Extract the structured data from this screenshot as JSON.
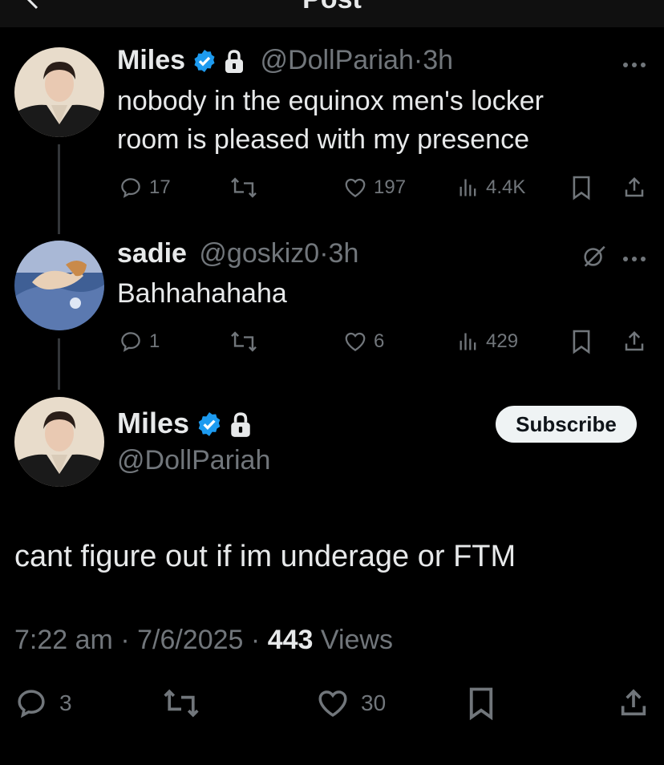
{
  "topbar": {
    "title": "Post"
  },
  "thread": [
    {
      "name": "Miles",
      "handle": "@DollPariah",
      "dot": "·",
      "time": "3h",
      "verified": true,
      "protected": true,
      "text_line1": "nobody in the equinox men's locker",
      "text_line2": "room is pleased with my presence",
      "replies": "17",
      "likes": "197",
      "views": "4.4K"
    },
    {
      "name": "sadie",
      "handle": "@goskiz0",
      "dot": "·",
      "time": "3h",
      "text": "Bahhahahaha",
      "replies": "1",
      "likes": "6",
      "views": "429"
    }
  ],
  "main": {
    "name": "Miles",
    "handle": "@DollPariah",
    "subscribe_label": "Subscribe",
    "text": "cant figure out if im underage or FTM",
    "time": "7:22 am",
    "sep": "·",
    "date": "7/6/2025",
    "views_count": "443",
    "views_label": "Views",
    "replies": "3",
    "likes": "30"
  },
  "colors": {
    "accent": "#1d9bf0",
    "muted": "#71767b",
    "text": "#e7e9ea",
    "background": "#000000"
  }
}
